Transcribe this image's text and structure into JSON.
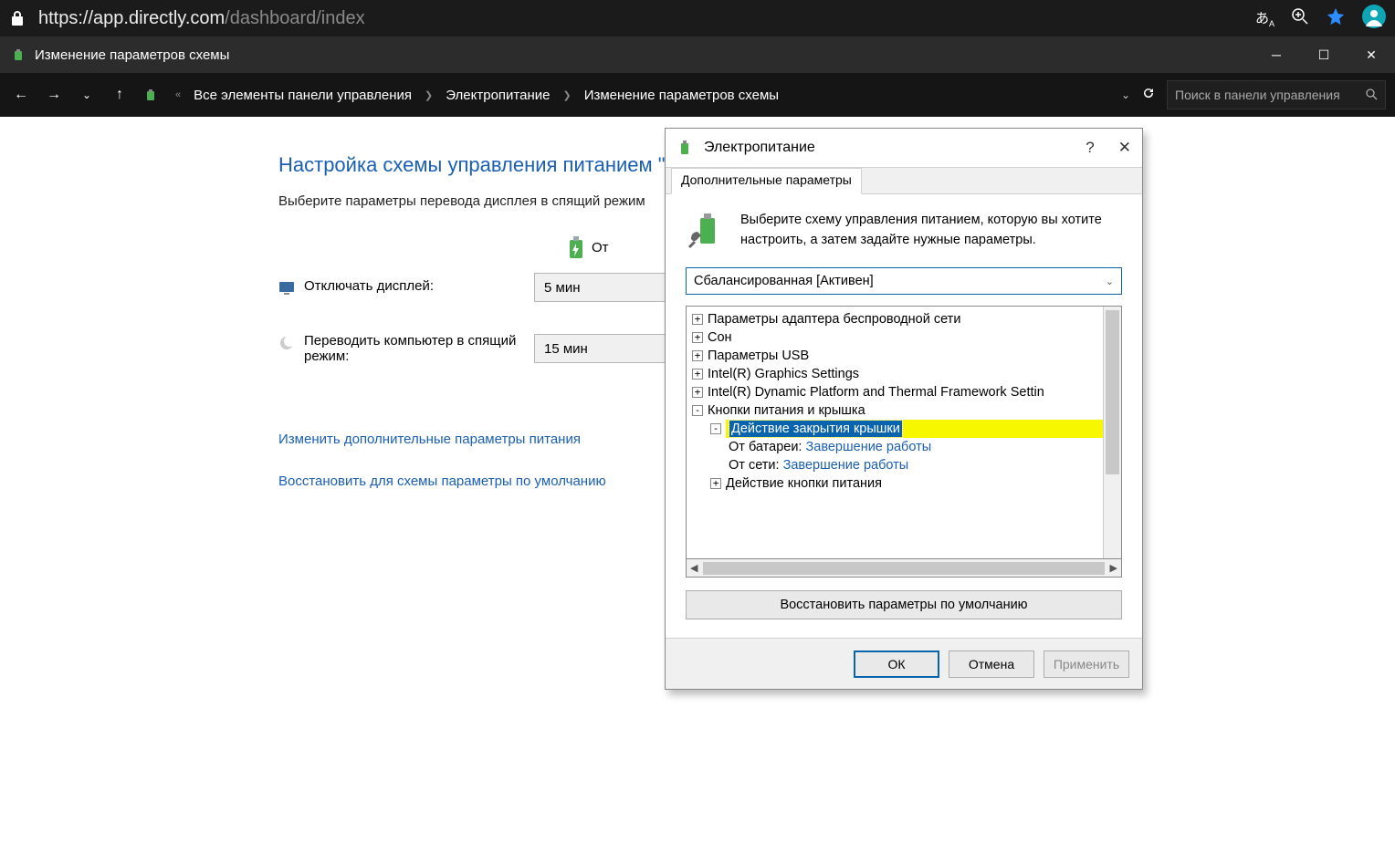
{
  "browser": {
    "url_host": "https://app.directly.com",
    "url_path": "/dashboard/index"
  },
  "window": {
    "title": "Изменение параметров схемы"
  },
  "breadcrumbs": {
    "root_hint": "«",
    "root": "Все элементы панели управления",
    "mid": "Электропитание",
    "leaf": "Изменение параметров схемы",
    "search_placeholder": "Поиск в панели управления"
  },
  "page": {
    "heading": "Настройка схемы управления питанием \"",
    "instruction": "Выберите параметры перевода дисплея в спящий режим",
    "col_battery": "От",
    "row_display_label": "Отключать дисплей:",
    "row_display_val": "5 мин",
    "row_sleep_label": "Переводить компьютер в спящий режим:",
    "row_sleep_val": "15 мин",
    "link_advanced": "Изменить дополнительные параметры питания",
    "link_restore": "Восстановить для схемы параметры по умолчанию"
  },
  "dialog": {
    "title": "Электропитание",
    "tab": "Дополнительные параметры",
    "message": "Выберите схему управления питанием, которую вы хотите настроить, а затем задайте нужные параметры.",
    "scheme": "Сбалансированная [Активен]",
    "tree": {
      "n1": "Параметры адаптера беспроводной сети",
      "n2": "Сон",
      "n3": "Параметры USB",
      "n4": "Intel(R) Graphics Settings",
      "n5": "Intel(R) Dynamic Platform and Thermal Framework Settin",
      "n6": "Кнопки питания и крышка",
      "n6a": "Действие закрытия крышки",
      "n6a1_label": "От батареи:",
      "n6a1_val": "Завершение работы",
      "n6a2_label": "От сети:",
      "n6a2_val": "Завершение работы",
      "n6b": "Действие кнопки питания"
    },
    "restore": "Восстановить параметры по умолчанию",
    "ok": "ОК",
    "cancel": "Отмена",
    "apply": "Применить"
  }
}
